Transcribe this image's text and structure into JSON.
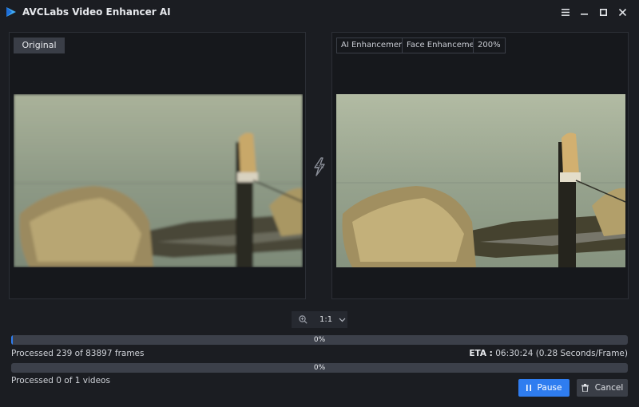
{
  "app": {
    "title": "AVCLabs Video Enhancer AI"
  },
  "left_panel": {
    "label": "Original"
  },
  "right_panel": {
    "tags": [
      "AI Enhancement",
      "Face Enhancement",
      "200%"
    ]
  },
  "zoom": {
    "value": "1:1"
  },
  "progress": {
    "frames": {
      "percent": 0.28,
      "label": "0%",
      "status": "Processed 239 of 83897 frames"
    },
    "eta": {
      "label": "ETA :",
      "value": "06:30:24 (0.28 Seconds/Frame)"
    },
    "videos": {
      "percent": 0,
      "label": "0%",
      "status": "Processed 0 of 1 videos"
    }
  },
  "buttons": {
    "pause": "Pause",
    "cancel": "Cancel"
  },
  "icons": {
    "logo": "play-triangle-logo-icon",
    "menu": "hamburger-menu-icon",
    "minimize": "minimize-icon",
    "maximize": "maximize-icon",
    "close": "close-icon",
    "gpu": "gpu-lightning-icon",
    "zoom": "zoom-in-icon",
    "dropdown": "chevron-down-icon"
  },
  "colors": {
    "accent": "#2f7df0",
    "background": "#1b1d22",
    "panel": "#16181c"
  }
}
